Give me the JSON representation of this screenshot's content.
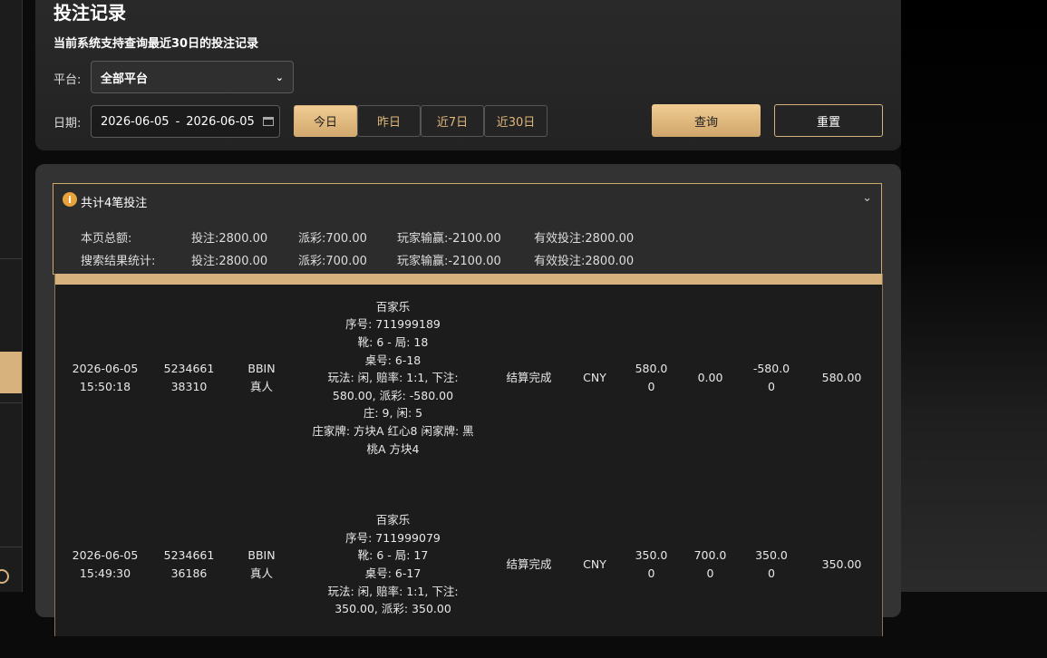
{
  "page": {
    "title": "投注记录",
    "subtitle": "当前系统支持查询最近30日的投注记录"
  },
  "filters": {
    "platform_label": "平台:",
    "platform_value": "全部平台",
    "date_label": "日期:",
    "date_start": "2026-06-05",
    "date_sep": "-",
    "date_end": "2026-06-05",
    "quick_ranges": [
      "今日",
      "昨日",
      "近7日",
      "近30日"
    ],
    "active_range": "今日",
    "query_label": "查询",
    "reset_label": "重置"
  },
  "summary": {
    "title": "共计4笔投注",
    "rows": [
      {
        "label": "本页总额:",
        "bet": "投注:2800.00",
        "payout": "派彩:700.00",
        "win": "玩家输赢:-2100.00",
        "valid": "有效投注:2800.00"
      },
      {
        "label": "搜索结果统计:",
        "bet": "投注:2800.00",
        "payout": "派彩:700.00",
        "win": "玩家输赢:-2100.00",
        "valid": "有效投注:2800.00"
      }
    ]
  },
  "records": [
    {
      "time_date": "2026-06-05",
      "time_clock": "15:50:18",
      "id_a": "5234661",
      "id_b": "38310",
      "platform": "BBIN",
      "category": "真人",
      "detail": [
        "百家乐",
        "序号: 711999189",
        "靴: 6 - 局: 18",
        "桌号: 6-18",
        "玩法: 闲, 赔率: 1:1, 下注:",
        "580.00, 派彩: -580.00",
        "庄: 9, 闲: 5",
        "庄家牌: 方块A 红心8 闲家牌: 黑",
        "桃A 方块4"
      ],
      "status": "结算完成",
      "currency": "CNY",
      "bet_a": "580.0",
      "bet_b": "0",
      "payout_a": "0.00",
      "payout_b": "",
      "win_a": "-580.0",
      "win_b": "0",
      "valid": "580.00"
    },
    {
      "time_date": "2026-06-05",
      "time_clock": "15:49:30",
      "id_a": "5234661",
      "id_b": "36186",
      "platform": "BBIN",
      "category": "真人",
      "detail": [
        "百家乐",
        "序号: 711999079",
        "靴: 6 - 局: 17",
        "桌号: 6-17",
        "玩法: 闲, 赔率: 1:1, 下注:",
        "350.00, 派彩: 350.00"
      ],
      "status": "结算完成",
      "currency": "CNY",
      "bet_a": "350.0",
      "bet_b": "0",
      "payout_a": "700.0",
      "payout_b": "0",
      "win_a": "350.0",
      "win_b": "0",
      "valid": "350.00"
    }
  ]
}
